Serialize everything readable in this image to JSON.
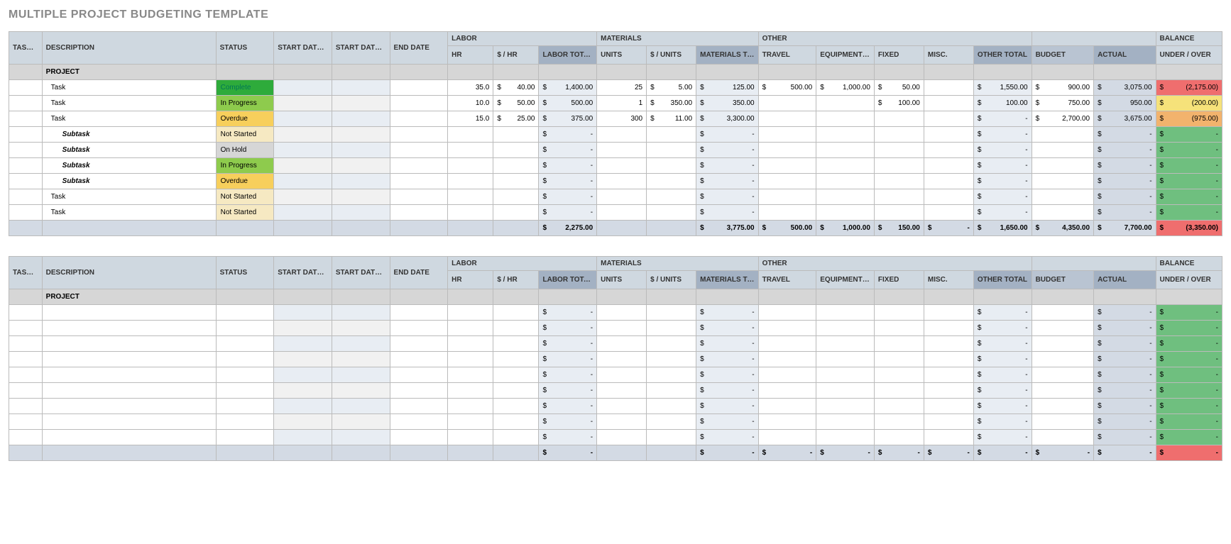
{
  "title": "MULTIPLE PROJECT BUDGETING TEMPLATE",
  "groups": {
    "labor": "LABOR",
    "materials": "MATERIALS",
    "other": "OTHER",
    "balance": "BALANCE"
  },
  "headers": {
    "task_id": "TASK ID",
    "description": "DESCRIPTION",
    "status": "STATUS",
    "start_planned": "START DATE PLANNED",
    "start_actual": "START DATE ACTUAL",
    "end_date": "END DATE",
    "hr": "HR",
    "per_hr": "$ / HR",
    "labor_total": "LABOR TOTAL",
    "units": "UNITS",
    "per_unit": "$ / UNITS",
    "materials_total": "MATERIALS TOTAL",
    "travel": "TRAVEL",
    "equip": "EQUIPMENT / SPACE",
    "fixed": "FIXED",
    "misc": "MISC.",
    "other_total": "OTHER TOTAL",
    "budget": "BUDGET",
    "actual": "ACTUAL",
    "under_over": "UNDER / OVER"
  },
  "project_label": "PROJECT",
  "status_labels": {
    "complete": "Complete",
    "progress": "In Progress",
    "overdue": "Overdue",
    "notstarted": "Not Started",
    "onhold": "On Hold"
  },
  "tables": [
    {
      "rows": [
        {
          "desc": "Task",
          "indent": 1,
          "status": "complete",
          "alt": "blue",
          "hr": "35.0",
          "perhr": "40.00",
          "labortot": "1,400.00",
          "units": "25",
          "perunit": "5.00",
          "mattot": "125.00",
          "travel": "500.00",
          "equip": "1,000.00",
          "fixed": "50.00",
          "misc": "",
          "othertot": "1,550.00",
          "budget": "900.00",
          "actual": "3,075.00",
          "bal": "(2,175.00)",
          "balcls": "bal-red"
        },
        {
          "desc": "Task",
          "indent": 1,
          "status": "progress",
          "alt": "grey",
          "hr": "10.0",
          "perhr": "50.00",
          "labortot": "500.00",
          "units": "1",
          "perunit": "350.00",
          "mattot": "350.00",
          "travel": "",
          "equip": "",
          "fixed": "100.00",
          "misc": "",
          "othertot": "100.00",
          "budget": "750.00",
          "actual": "950.00",
          "bal": "(200.00)",
          "balcls": "bal-yellow"
        },
        {
          "desc": "Task",
          "indent": 1,
          "status": "overdue",
          "alt": "blue",
          "hr": "15.0",
          "perhr": "25.00",
          "labortot": "375.00",
          "units": "300",
          "perunit": "11.00",
          "mattot": "3,300.00",
          "travel": "",
          "equip": "",
          "fixed": "",
          "misc": "",
          "othertot": "-",
          "budget": "2,700.00",
          "actual": "3,675.00",
          "bal": "(975.00)",
          "balcls": "bal-orange"
        },
        {
          "desc": "Subtask",
          "indent": 2,
          "status": "notstarted",
          "alt": "grey",
          "labortot": "-",
          "mattot": "-",
          "othertot": "-",
          "actual": "-",
          "bal": "-",
          "balcls": "bal-green"
        },
        {
          "desc": "Subtask",
          "indent": 2,
          "status": "onhold",
          "alt": "blue",
          "labortot": "-",
          "mattot": "-",
          "othertot": "-",
          "actual": "-",
          "bal": "-",
          "balcls": "bal-green"
        },
        {
          "desc": "Subtask",
          "indent": 2,
          "status": "progress",
          "alt": "grey",
          "labortot": "-",
          "mattot": "-",
          "othertot": "-",
          "actual": "-",
          "bal": "-",
          "balcls": "bal-green"
        },
        {
          "desc": "Subtask",
          "indent": 2,
          "status": "overdue",
          "alt": "blue",
          "labortot": "-",
          "mattot": "-",
          "othertot": "-",
          "actual": "-",
          "bal": "-",
          "balcls": "bal-green"
        },
        {
          "desc": "Task",
          "indent": 1,
          "status": "notstarted",
          "alt": "grey",
          "labortot": "-",
          "mattot": "-",
          "othertot": "-",
          "actual": "-",
          "bal": "-",
          "balcls": "bal-green"
        },
        {
          "desc": "Task",
          "indent": 1,
          "status": "notstarted",
          "alt": "blue",
          "labortot": "-",
          "mattot": "-",
          "othertot": "-",
          "actual": "-",
          "bal": "-",
          "balcls": "bal-green"
        }
      ],
      "totals": {
        "labortot": "2,275.00",
        "mattot": "3,775.00",
        "travel": "500.00",
        "equip": "1,000.00",
        "fixed": "150.00",
        "misc": "-",
        "othertot": "1,650.00",
        "budget": "4,350.00",
        "actual": "7,700.00",
        "bal": "(3,350.00)",
        "balcls": "bal-red"
      }
    },
    {
      "rows": [
        {
          "alt": "blue",
          "labortot": "-",
          "mattot": "-",
          "othertot": "-",
          "actual": "-",
          "bal": "-",
          "balcls": "bal-green"
        },
        {
          "alt": "grey",
          "labortot": "-",
          "mattot": "-",
          "othertot": "-",
          "actual": "-",
          "bal": "-",
          "balcls": "bal-green"
        },
        {
          "alt": "blue",
          "labortot": "-",
          "mattot": "-",
          "othertot": "-",
          "actual": "-",
          "bal": "-",
          "balcls": "bal-green"
        },
        {
          "alt": "grey",
          "labortot": "-",
          "mattot": "-",
          "othertot": "-",
          "actual": "-",
          "bal": "-",
          "balcls": "bal-green"
        },
        {
          "alt": "blue",
          "labortot": "-",
          "mattot": "-",
          "othertot": "-",
          "actual": "-",
          "bal": "-",
          "balcls": "bal-green"
        },
        {
          "alt": "grey",
          "labortot": "-",
          "mattot": "-",
          "othertot": "-",
          "actual": "-",
          "bal": "-",
          "balcls": "bal-green"
        },
        {
          "alt": "blue",
          "labortot": "-",
          "mattot": "-",
          "othertot": "-",
          "actual": "-",
          "bal": "-",
          "balcls": "bal-green"
        },
        {
          "alt": "grey",
          "labortot": "-",
          "mattot": "-",
          "othertot": "-",
          "actual": "-",
          "bal": "-",
          "balcls": "bal-green"
        },
        {
          "alt": "blue",
          "labortot": "-",
          "mattot": "-",
          "othertot": "-",
          "actual": "-",
          "bal": "-",
          "balcls": "bal-green"
        }
      ],
      "totals": {
        "labortot": "-",
        "mattot": "-",
        "travel": "-",
        "equip": "-",
        "fixed": "-",
        "misc": "-",
        "othertot": "-",
        "budget": "-",
        "actual": "-",
        "bal": "-",
        "balcls": "bal-red"
      }
    }
  ]
}
